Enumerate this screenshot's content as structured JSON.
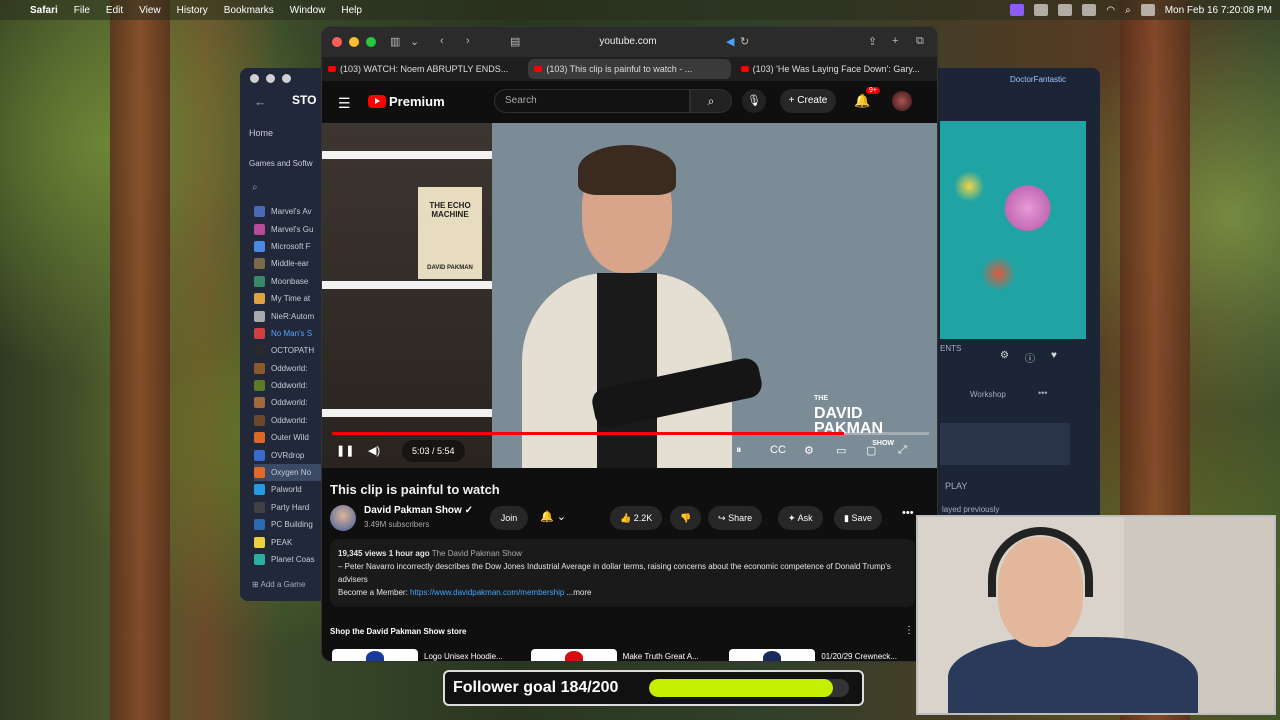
{
  "menubar": {
    "app": "Safari",
    "items": [
      "File",
      "Edit",
      "View",
      "History",
      "Bookmarks",
      "Window",
      "Help"
    ],
    "clock": "Mon Feb 16  7:20:08 PM"
  },
  "steam": {
    "store_label": "STO",
    "home": "Home",
    "games_header": "Games and Softw",
    "user": "DoctorFantastic",
    "games": [
      {
        "name": "Marvel's Av",
        "color": "#4a6ab8"
      },
      {
        "name": "Marvel's Gu",
        "color": "#b84a9a"
      },
      {
        "name": "Microsoft F",
        "color": "#4a8ae0"
      },
      {
        "name": "Middle-ear",
        "color": "#7a6a4a"
      },
      {
        "name": "Moonbase",
        "color": "#3a8a6a"
      },
      {
        "name": "My Time at",
        "color": "#e0a040"
      },
      {
        "name": "NieR:Autom",
        "color": "#aaaaaa"
      },
      {
        "name": "No Man's S",
        "color": "#d04040"
      },
      {
        "name": "OCTOPATH",
        "color": "#2a2a2a"
      },
      {
        "name": "Oddworld:",
        "color": "#8a5a2a"
      },
      {
        "name": "Oddworld:",
        "color": "#5a7a2a"
      },
      {
        "name": "Oddworld:",
        "color": "#a06a3a"
      },
      {
        "name": "Oddworld:",
        "color": "#6a4a2a"
      },
      {
        "name": "Outer Wild",
        "color": "#d86a2a"
      },
      {
        "name": "OVRdrop",
        "color": "#3a6ad0"
      },
      {
        "name": "Oxygen No",
        "color": "#e06a2a"
      },
      {
        "name": "Palworld",
        "color": "#2a9ae0"
      },
      {
        "name": "Party Hard",
        "color": "#404040"
      },
      {
        "name": "PC Building",
        "color": "#2a6ab0"
      },
      {
        "name": "PEAK",
        "color": "#f0d040"
      },
      {
        "name": "Planet Coas",
        "color": "#2ab0a0"
      }
    ],
    "add_game": "Add a Game",
    "ents": "ENTS",
    "workshop": "Workshop",
    "play": "PLAY",
    "last_played": "layed previously"
  },
  "safari": {
    "address": "youtube.com",
    "tabs": [
      "(103) WATCH: Noem ABRUPTLY ENDS...",
      "(103) This clip is painful to watch - ...",
      "(103) 'He Was Laying Face Down': Gary..."
    ]
  },
  "youtube": {
    "logo": "Premium",
    "search_placeholder": "Search",
    "create": "Create",
    "notif_badge": "9+",
    "video": {
      "book_title": "THE ECHO MACHINE",
      "book_author": "DAVID PAKMAN",
      "overlay_the": "THE",
      "overlay_name": "DAVID PAKMAN",
      "overlay_show": "SHOW",
      "time": "5:03 / 5:54",
      "progress": 0.857
    },
    "title": "This clip is painful to watch",
    "channel": "David Pakman Show",
    "subscribers": "3.49M subscribers",
    "join": "Join",
    "likes": "2.2K",
    "share": "Share",
    "ask": "Ask",
    "save": "Save",
    "desc_stats": "19,345 views  1 hour ago",
    "desc_tag": "The David Pakman Show",
    "desc_text": "– Peter Navarro incorrectly describes the Dow Jones Industrial Average in dollar terms, raising concerns about the economic competence of Donald Trump's advisers",
    "desc_member": "Become a Member: ",
    "desc_link": "https://www.davidpakman.com/membership",
    "desc_more": "...more",
    "shop_header": "Shop the David Pakman Show store",
    "products": [
      {
        "name": "Logo Unisex Hoodie...",
        "cap": "#1a3a9a"
      },
      {
        "name": "Make Truth Great A...",
        "cap": "#d01010"
      },
      {
        "name": "01/20/29 Crewneck...",
        "cap": "#1a2a5a"
      }
    ]
  },
  "follower_goal": {
    "text": "Follower goal 184/200",
    "progress": 0.92,
    "color": "#c4f000"
  }
}
